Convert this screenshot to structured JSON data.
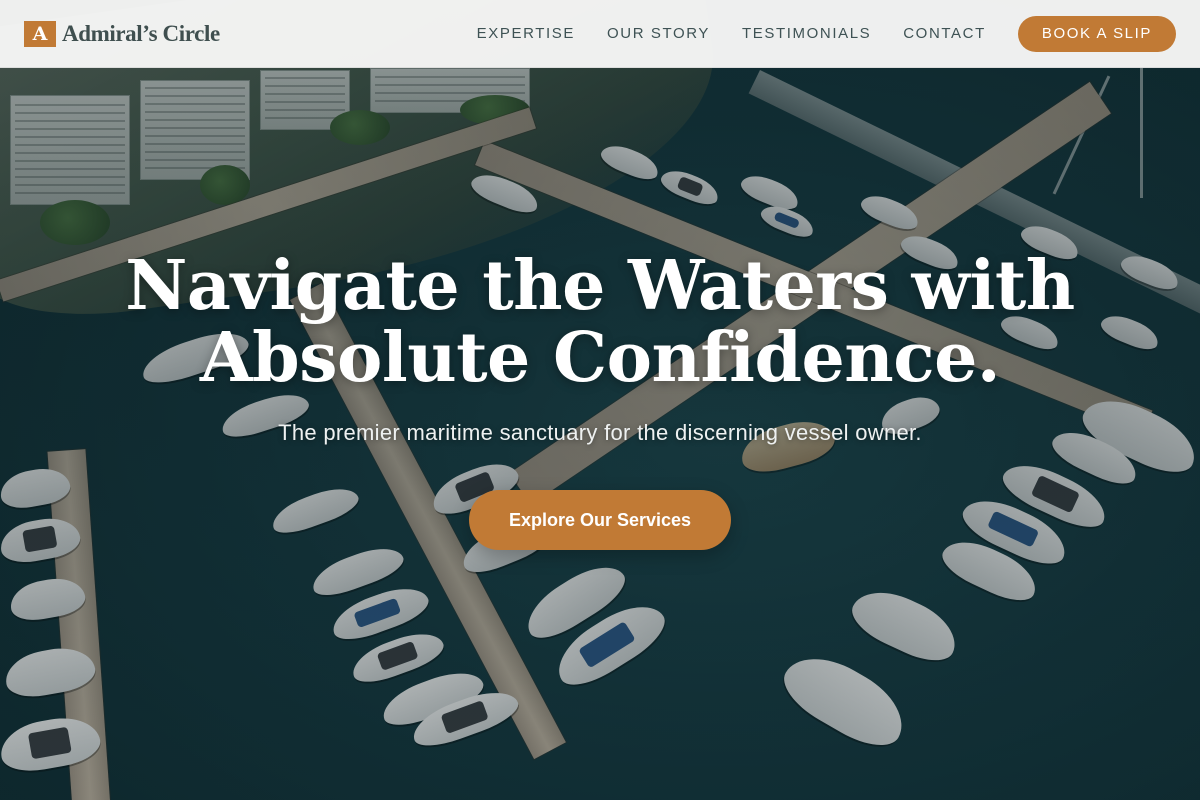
{
  "brand": {
    "mark": "A",
    "name": "Admiral’s Circle"
  },
  "nav": {
    "links": [
      "EXPERTISE",
      "OUR STORY",
      "TESTIMONIALS",
      "CONTACT"
    ],
    "cta_label": "BOOK A SLIP"
  },
  "hero": {
    "headline_line1": "Navigate the Waters with",
    "headline_line2": "Absolute Confidence.",
    "subhead": "The premier maritime sanctuary for the discerning vessel owner.",
    "cta_label": "Explore Our Services"
  },
  "colors": {
    "accent": "#c17a35",
    "brand_text": "#3f4f4f",
    "nav_text": "#3e5254",
    "navbar_bg": "#f8f8f7"
  }
}
